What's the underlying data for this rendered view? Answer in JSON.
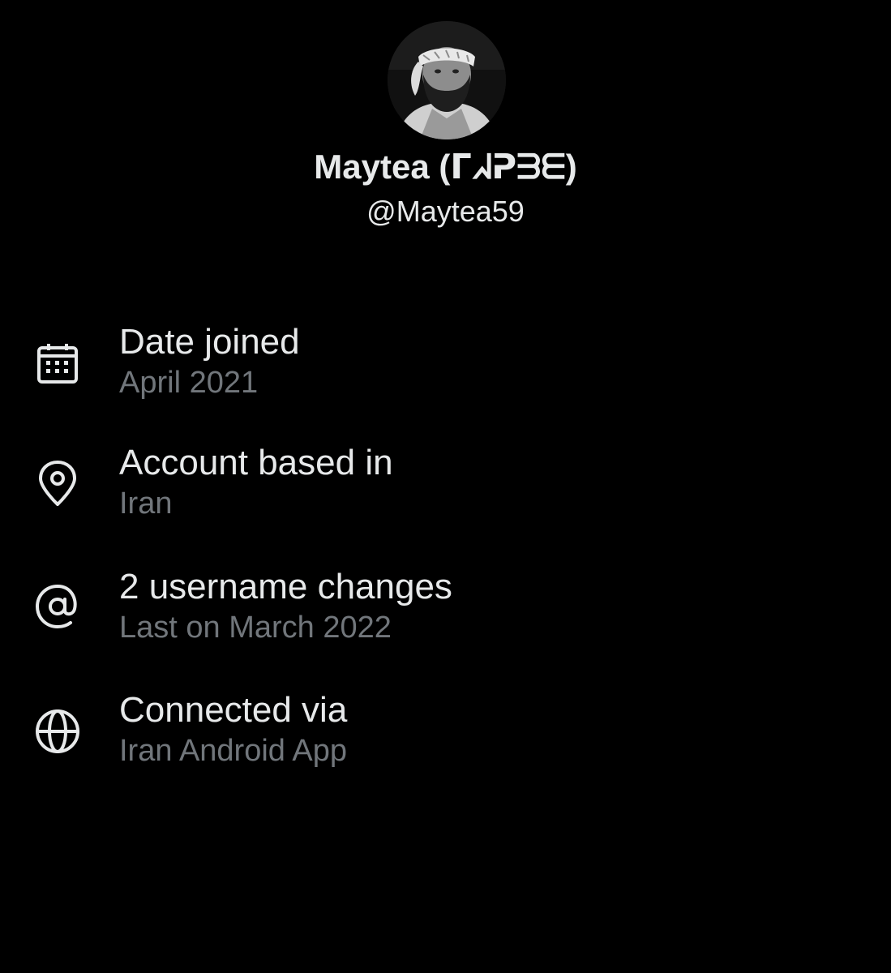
{
  "profile": {
    "display_name": "Maytea (ᒥᖽᕈᗱᗴ)",
    "handle": "@Maytea59",
    "avatar_description_icon": "user-photo"
  },
  "about": {
    "items": [
      {
        "icon": "calendar-icon",
        "title": "Date joined",
        "value": "April 2021"
      },
      {
        "icon": "location-pin-icon",
        "title": "Account based in",
        "value": "Iran"
      },
      {
        "icon": "at-sign-icon",
        "title": "2 username changes",
        "value": "Last on March 2022"
      },
      {
        "icon": "globe-icon",
        "title": "Connected via",
        "value": "Iran Android App"
      }
    ]
  },
  "colors": {
    "background": "#000000",
    "primary_text": "#e7e9ea",
    "secondary_text": "#71767b"
  }
}
